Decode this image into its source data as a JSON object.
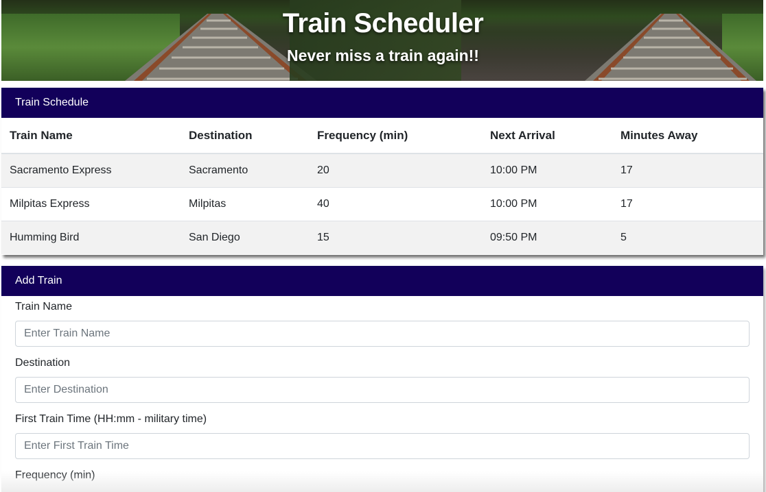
{
  "header": {
    "title": "Train Scheduler",
    "subtitle": "Never miss a train again!!"
  },
  "schedule": {
    "heading": "Train Schedule",
    "columns": [
      "Train Name",
      "Destination",
      "Frequency (min)",
      "Next Arrival",
      "Minutes Away"
    ],
    "rows": [
      [
        "Sacramento Express",
        "Sacramento",
        "20",
        "10:00 PM",
        "17"
      ],
      [
        "Milpitas Express",
        "Milpitas",
        "40",
        "10:00 PM",
        "17"
      ],
      [
        "Humming Bird",
        "San Diego",
        "15",
        "09:50 PM",
        "5"
      ]
    ]
  },
  "add_train": {
    "heading": "Add Train",
    "fields": [
      {
        "label": "Train Name",
        "placeholder": "Enter Train Name",
        "value": ""
      },
      {
        "label": "Destination",
        "placeholder": "Enter Destination",
        "value": ""
      },
      {
        "label": "First Train Time (HH:mm - military time)",
        "placeholder": "Enter First Train Time",
        "value": ""
      },
      {
        "label": "Frequency (min)",
        "placeholder": "",
        "value": ""
      }
    ]
  },
  "colors": {
    "card_header": "#12005a",
    "stripe_row": "#f2f2f2"
  }
}
